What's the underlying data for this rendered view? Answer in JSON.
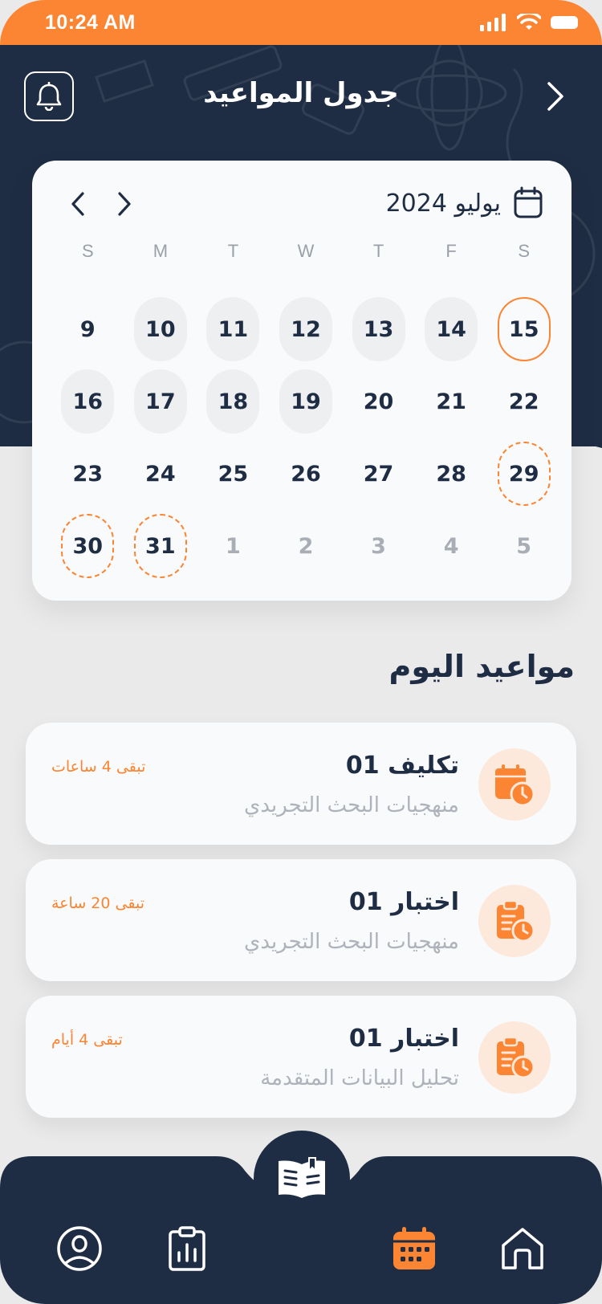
{
  "status_bar": {
    "time": "10:24 AM"
  },
  "header": {
    "title": "جدول المواعيد"
  },
  "calendar": {
    "month_label": "يوليو 2024",
    "weekdays": [
      "S",
      "M",
      "T",
      "W",
      "T",
      "F",
      "S"
    ],
    "weeks": [
      [
        {
          "day": "9",
          "style": "plain"
        },
        {
          "day": "10",
          "style": "filled"
        },
        {
          "day": "11",
          "style": "filled"
        },
        {
          "day": "12",
          "style": "filled"
        },
        {
          "day": "13",
          "style": "filled"
        },
        {
          "day": "14",
          "style": "filled"
        },
        {
          "day": "15",
          "style": "today"
        }
      ],
      [
        {
          "day": "16",
          "style": "filled"
        },
        {
          "day": "17",
          "style": "filled"
        },
        {
          "day": "18",
          "style": "filled"
        },
        {
          "day": "19",
          "style": "filled"
        },
        {
          "day": "20",
          "style": "plain"
        },
        {
          "day": "21",
          "style": "plain"
        },
        {
          "day": "22",
          "style": "plain"
        }
      ],
      [
        {
          "day": "23",
          "style": "plain"
        },
        {
          "day": "24",
          "style": "plain"
        },
        {
          "day": "25",
          "style": "plain"
        },
        {
          "day": "26",
          "style": "plain"
        },
        {
          "day": "27",
          "style": "plain"
        },
        {
          "day": "28",
          "style": "plain"
        },
        {
          "day": "29",
          "style": "deadline"
        }
      ],
      [
        {
          "day": "30",
          "style": "deadline"
        },
        {
          "day": "31",
          "style": "deadline"
        },
        {
          "day": "1",
          "style": "muted"
        },
        {
          "day": "2",
          "style": "muted"
        },
        {
          "day": "3",
          "style": "muted"
        },
        {
          "day": "4",
          "style": "muted"
        },
        {
          "day": "5",
          "style": "muted"
        }
      ]
    ]
  },
  "today_section": {
    "title": "مواعيد اليوم",
    "items": [
      {
        "title": "تكليف 01",
        "subtitle": "منهجيات البحث التجريدي",
        "remaining": "تبقى 4 ساعات",
        "icon": "calendar-clock-icon"
      },
      {
        "title": "اختبار 01",
        "subtitle": "منهجيات البحث التجريدي",
        "remaining": "تبقى 20 ساعة",
        "icon": "clipboard-clock-icon"
      },
      {
        "title": "اختبار 01",
        "subtitle": "تحليل البيانات المتقدمة",
        "remaining": "تبقى 4 أيام",
        "icon": "clipboard-clock-icon"
      }
    ]
  },
  "bottom_nav": {
    "items": [
      "profile-icon",
      "report-icon",
      "calendar-icon",
      "home-icon"
    ],
    "active": "calendar-icon",
    "center": "book-icon"
  },
  "colors": {
    "accent": "#fb8533",
    "navy": "#1f2d44",
    "background": "#eaeaea",
    "card": "#f9fafb"
  }
}
